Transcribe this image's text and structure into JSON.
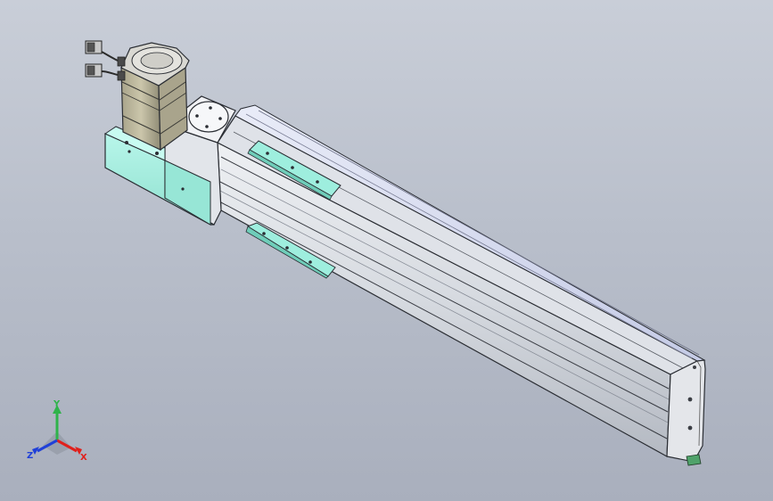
{
  "viewport": {
    "background_top": "#c9ced8",
    "background_bottom": "#a9afbd"
  },
  "colors": {
    "profile_light": "#e6e8ec",
    "profile_mid": "#cfd3da",
    "profile_dark": "#9aa0aa",
    "edge": "#2a2d33",
    "cover_blue": "#cfd6f2",
    "mount_cyan": "#a6efe0",
    "motor_body": "#b9b49a",
    "motor_dark": "#4a4a4a"
  },
  "triad": {
    "x_label": "X",
    "y_label": "Y",
    "z_label": "Z",
    "x_color": "#e0201c",
    "y_color": "#2fb34a",
    "z_color": "#2040d8"
  }
}
